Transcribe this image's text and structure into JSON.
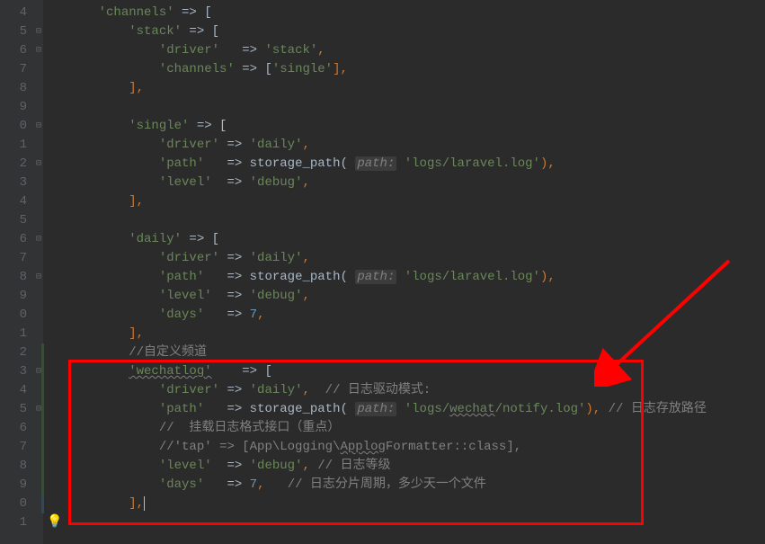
{
  "gutter": {
    "lines": [
      "4",
      "5",
      "6",
      "7",
      "8",
      "9",
      "0",
      "1",
      "2",
      "3",
      "4",
      "5",
      "6",
      "7",
      "8",
      "9",
      "0",
      "1",
      "2",
      "3",
      "4",
      "5",
      "6",
      "7",
      "8",
      "9",
      "0",
      "1"
    ]
  },
  "code": {
    "l4": {
      "key": "'channels'",
      "arrow": " => [",
      "indent": "    "
    },
    "l5": {
      "key": "'stack'",
      "arrow": " => [",
      "indent": "        "
    },
    "l6": {
      "key": "'driver'",
      "arrow": "   => ",
      "val": "'stack'",
      "end": ",",
      "indent": "            "
    },
    "l7": {
      "key": "'channels'",
      "arrow": " => [",
      "val": "'single'",
      "end": "],",
      "indent": "            "
    },
    "l8": {
      "text": "],",
      "indent": "        "
    },
    "l9": {
      "text": "",
      "indent": ""
    },
    "l10": {
      "key": "'single'",
      "arrow": " => [",
      "indent": "        "
    },
    "l11": {
      "key": "'driver'",
      "arrow": " => ",
      "val": "'daily'",
      "end": ",",
      "indent": "            "
    },
    "l12": {
      "key": "'path'",
      "arrow": "   => ",
      "fn": "storage_path",
      "param": "path:",
      "val": "'logs/laravel.log'",
      "end": "),",
      "indent": "            "
    },
    "l13": {
      "key": "'level'",
      "arrow": "  => ",
      "val": "'debug'",
      "end": ",",
      "indent": "            "
    },
    "l14": {
      "text": "],",
      "indent": "        "
    },
    "l15": {
      "text": "",
      "indent": ""
    },
    "l16": {
      "key": "'daily'",
      "arrow": " => [",
      "indent": "        "
    },
    "l17": {
      "key": "'driver'",
      "arrow": " => ",
      "val": "'daily'",
      "end": ",",
      "indent": "            "
    },
    "l18": {
      "key": "'path'",
      "arrow": "   => ",
      "fn": "storage_path",
      "param": "path:",
      "val": "'logs/laravel.log'",
      "end": "),",
      "indent": "            "
    },
    "l19": {
      "key": "'level'",
      "arrow": "  => ",
      "val": "'debug'",
      "end": ",",
      "indent": "            "
    },
    "l20": {
      "key": "'days'",
      "arrow": "   => ",
      "num": "7",
      "end": ",",
      "indent": "            "
    },
    "l21": {
      "text": "],",
      "indent": "        "
    },
    "l22": {
      "cmt": "//自定义频道",
      "indent": "        "
    },
    "l23": {
      "key": "'wechatlog'",
      "arrow": "    => [",
      "indent": "        ",
      "underline": true
    },
    "l24": {
      "key": "'driver'",
      "arrow": " => ",
      "val": "'daily'",
      "end": ",",
      "cmt": "  // 日志驱动模式:",
      "indent": "            "
    },
    "l25": {
      "key": "'path'",
      "arrow": "   => ",
      "fn": "storage_path",
      "param": "path:",
      "val1": "'logs/",
      "val2": "wechat",
      "val3": "/notify.log'",
      "end": "),",
      "cmt": " // 日志存放路径",
      "indent": "            "
    },
    "l26": {
      "cmt": "//  挂载日志格式接口（重点）",
      "indent": "            "
    },
    "l27": {
      "cmt1": "//'tap' => [App\\Logging\\",
      "cmt2": "Applog",
      "cmt3": "Formatter::class],",
      "indent": "            "
    },
    "l28": {
      "key": "'level'",
      "arrow": "  => ",
      "val": "'debug'",
      "end": ",",
      "cmt": " // 日志等级",
      "indent": "            "
    },
    "l29": {
      "key": "'days'",
      "arrow": "   => ",
      "num": "7",
      "end": ", ",
      "cmt": "  // 日志分片周期，多少天一个文件",
      "indent": "            "
    },
    "l30": {
      "text": "],",
      "indent": "        "
    }
  },
  "chart_data": {
    "type": "table",
    "title": "PHP Laravel logging channels configuration",
    "channels": [
      {
        "name": "stack",
        "driver": "stack",
        "channels": [
          "single"
        ]
      },
      {
        "name": "single",
        "driver": "daily",
        "path": "logs/laravel.log",
        "level": "debug"
      },
      {
        "name": "daily",
        "driver": "daily",
        "path": "logs/laravel.log",
        "level": "debug",
        "days": 7
      },
      {
        "name": "wechatlog",
        "driver": "daily",
        "path": "logs/wechat/notify.log",
        "level": "debug",
        "days": 7,
        "comment": "自定义频道"
      }
    ]
  }
}
